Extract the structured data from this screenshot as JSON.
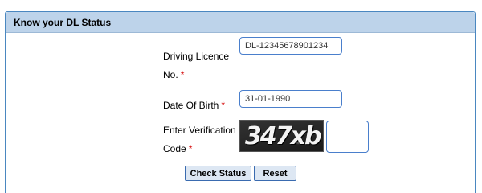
{
  "panel": {
    "title": "Know your DL Status"
  },
  "form": {
    "dl_label_line1": "Driving Licence",
    "dl_label_line2": "No.",
    "dl_value": "DL-12345678901234",
    "dob_label": "Date Of Birth",
    "dob_value": "31-01-1990",
    "captcha_label_line1": "Enter Verification",
    "captcha_label_line2": "Code",
    "captcha_text": "347xb",
    "captcha_value": "",
    "required_mark": "*"
  },
  "buttons": {
    "check_status": "Check Status",
    "reset": "Reset"
  },
  "colors": {
    "header_bg": "#bdd3ea",
    "border": "#4a87c0",
    "required": "#d40000"
  }
}
